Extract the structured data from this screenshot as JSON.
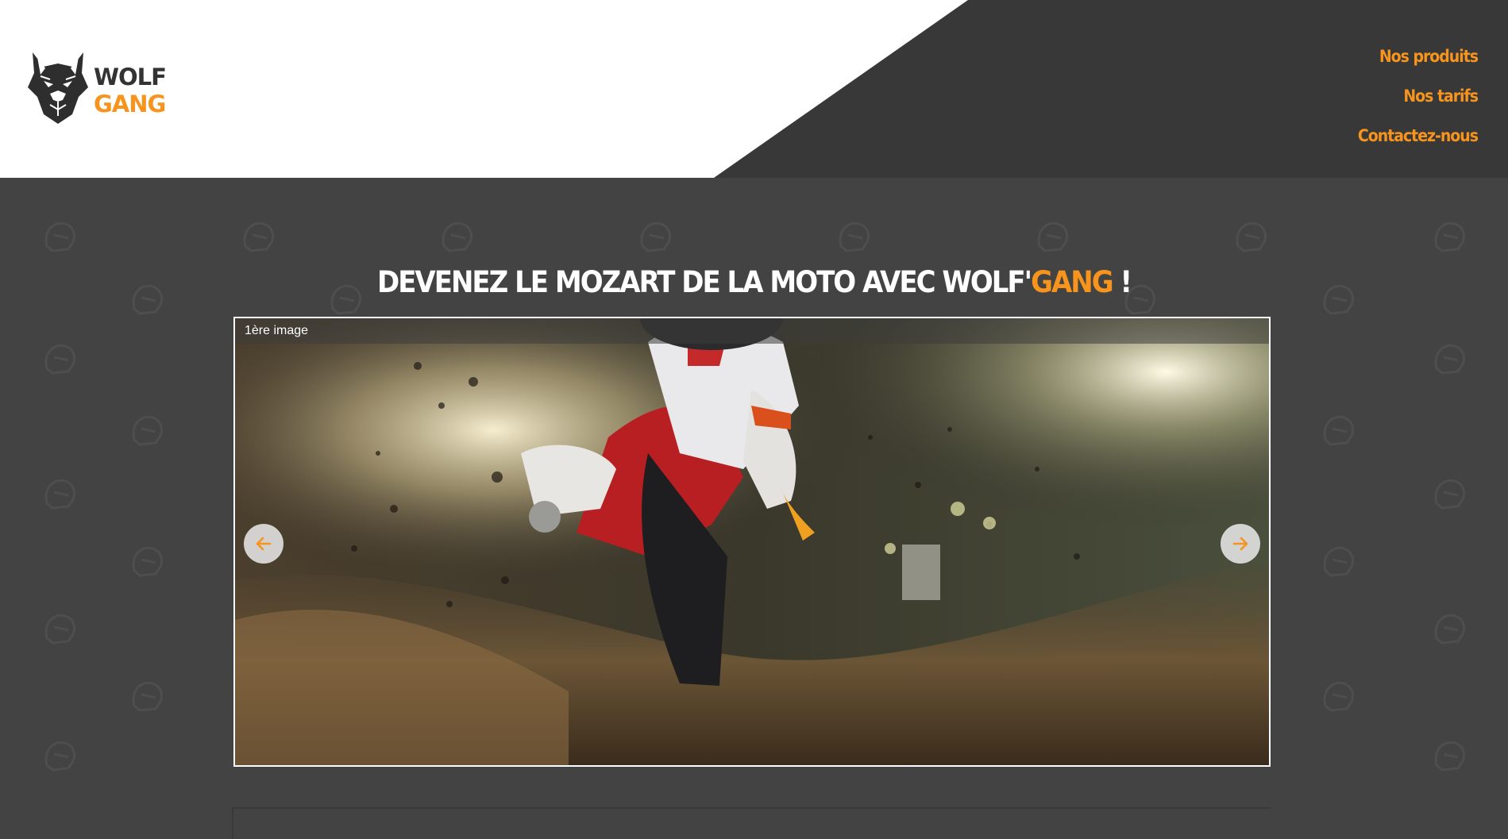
{
  "brand": {
    "line1": "WOLF",
    "line2": "GANG",
    "logo_icon": "wolf-head-icon"
  },
  "nav": [
    {
      "label": "Nos produits"
    },
    {
      "label": "Nos tarifs"
    },
    {
      "label": "Contactez-nous"
    }
  ],
  "headline": {
    "text": "DEVENEZ LE MOZART DE LA MOTO AVEC WOLF'",
    "accent": "GANG",
    "suffix": " !"
  },
  "slider": {
    "caption": "1ère image",
    "prev_icon": "arrow-left-icon",
    "next_icon": "arrow-right-icon"
  },
  "colors": {
    "accent": "#f7941d",
    "dark": "#383838",
    "background": "#434343",
    "white": "#ffffff"
  }
}
